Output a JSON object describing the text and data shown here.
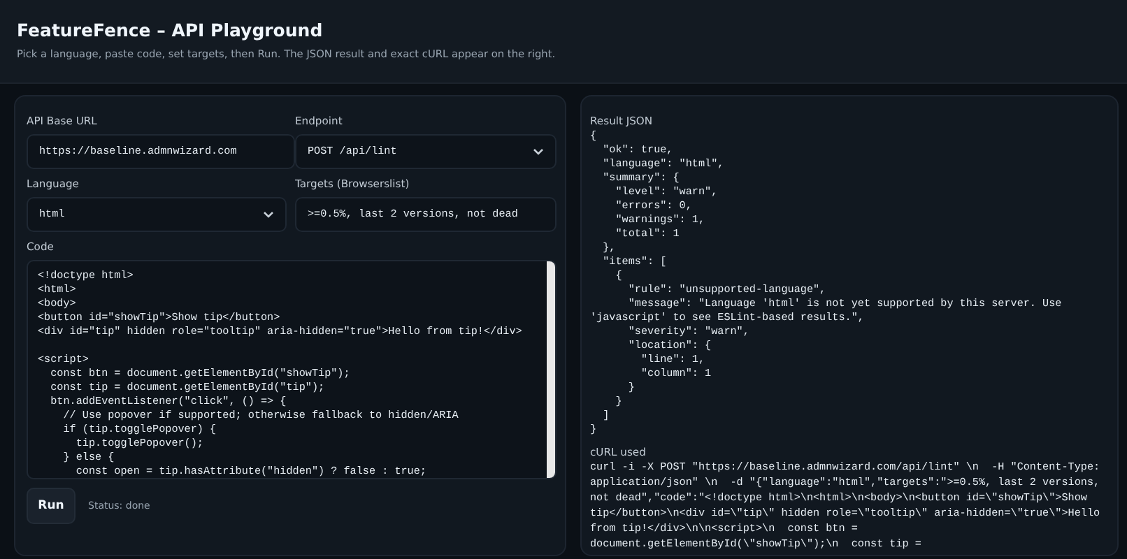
{
  "header": {
    "title": "FeatureFence – API Playground",
    "subtitle": "Pick a language, paste code, set targets, then Run. The JSON result and exact cURL appear on the right."
  },
  "form": {
    "api_base_url": {
      "label": "API Base URL",
      "value": "https://baseline.admnwizard.com"
    },
    "endpoint": {
      "label": "Endpoint",
      "value": "POST /api/lint"
    },
    "language": {
      "label": "Language",
      "value": "html"
    },
    "targets": {
      "label": "Targets (Browserslist)",
      "value": ">=0.5%, last 2 versions, not dead"
    },
    "code": {
      "label": "Code",
      "value": "<!doctype html>\n<html>\n<body>\n<button id=\"showTip\">Show tip</button>\n<div id=\"tip\" hidden role=\"tooltip\" aria-hidden=\"true\">Hello from tip!</div>\n\n<script>\n  const btn = document.getElementById(\"showTip\");\n  const tip = document.getElementById(\"tip\");\n  btn.addEventListener(\"click\", () => {\n    // Use popover if supported; otherwise fallback to hidden/ARIA\n    if (tip.togglePopover) {\n      tip.togglePopover();\n    } else {\n      const open = tip.hasAttribute(\"hidden\") ? false : true;"
    }
  },
  "run_button": "Run",
  "status": "Status: done",
  "result": {
    "label": "Result JSON",
    "text": "{\n  \"ok\": true,\n  \"language\": \"html\",\n  \"summary\": {\n    \"level\": \"warn\",\n    \"errors\": 0,\n    \"warnings\": 1,\n    \"total\": 1\n  },\n  \"items\": [\n    {\n      \"rule\": \"unsupported-language\",\n      \"message\": \"Language 'html' is not yet supported by this server. Use\n'javascript' to see ESLint-based results.\",\n      \"severity\": \"warn\",\n      \"location\": {\n        \"line\": 1,\n        \"column\": 1\n      }\n    }\n  ]\n}"
  },
  "curl": {
    "label": "cURL used",
    "text": "curl -i -X POST \"https://baseline.admnwizard.com/api/lint\" \\n  -H \"Content-Type:\napplication/json\" \\n  -d \"{\"language\":\"html\",\"targets\":\">=0.5%, last 2 versions,\nnot dead\",\"code\":\"<!doctype html>\\n<html>\\n<body>\\n<button id=\\\"showTip\\\">Show\ntip</button>\\n<div id=\\\"tip\\\" hidden role=\\\"tooltip\\\" aria-hidden=\\\"true\\\">Hello\nfrom tip!</div>\\n\\n<script>\\n  const btn =\ndocument.getElementById(\\\"showTip\\\");\\n  const tip ="
  }
}
